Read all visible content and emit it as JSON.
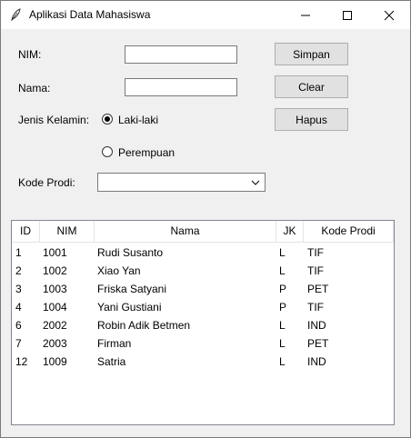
{
  "window": {
    "title": "Aplikasi Data Mahasiswa",
    "icon": "feather-icon",
    "controls": [
      "minimize-icon",
      "maximize-icon",
      "close-icon"
    ]
  },
  "form": {
    "nim_label": "NIM:",
    "nim_value": "",
    "nama_label": "Nama:",
    "nama_value": "",
    "gender_label": "Jenis Kelamin:",
    "gender_options": [
      "Laki-laki",
      "Perempuan"
    ],
    "gender_selected": "Laki-laki",
    "prodi_label": "Kode Prodi:",
    "prodi_value": ""
  },
  "buttons": {
    "save": "Simpan",
    "clear": "Clear",
    "delete": "Hapus"
  },
  "table": {
    "columns": [
      "ID",
      "NIM",
      "Nama",
      "JK",
      "Kode Prodi"
    ],
    "rows": [
      [
        "1",
        "1001",
        "Rudi Susanto",
        "L",
        "TIF"
      ],
      [
        "2",
        "1002",
        "Xiao Yan",
        "L",
        "TIF"
      ],
      [
        "3",
        "1003",
        "Friska Satyani",
        "P",
        "PET"
      ],
      [
        "4",
        "1004",
        "Yani Gustiani",
        "P",
        "TIF"
      ],
      [
        "6",
        "2002",
        "Robin Adik Betmen",
        "L",
        "IND"
      ],
      [
        "7",
        "2003",
        "Firman",
        "L",
        "PET"
      ],
      [
        "12",
        "1009",
        "Satria",
        "L",
        "IND"
      ]
    ]
  }
}
